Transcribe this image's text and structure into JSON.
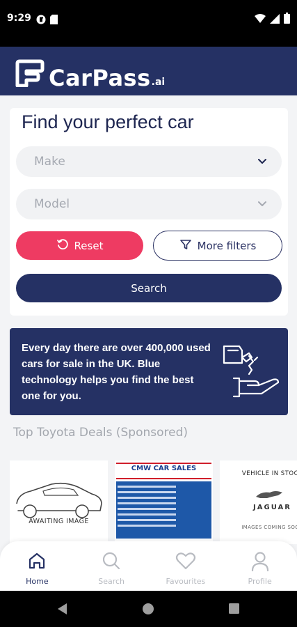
{
  "status_bar": {
    "time": "9:29"
  },
  "header": {
    "logo_text": "CarPass",
    "logo_suffix": ".ai"
  },
  "search_card": {
    "title": "Find your perfect car",
    "make_placeholder": "Make",
    "model_placeholder": "Model",
    "reset_label": "Reset",
    "filters_label": "More filters",
    "search_label": "Search"
  },
  "banner": {
    "text": "Every day there are over 400,000 used cars for sale in the UK. Blue technology helps you find the best one for you."
  },
  "deals": {
    "title": "Top Toyota Deals (Sponsored)",
    "cards": [
      {
        "image_text": "AWAITING IMAGE"
      },
      {
        "image_text": "CMW CAR SALES"
      },
      {
        "top_text": "VEHICLE IN STOCK",
        "brand_text": "JAGUAR",
        "bottom_text": "IMAGES COMING SOON"
      }
    ]
  },
  "bottom_nav": {
    "items": [
      {
        "label": "Home",
        "icon": "home-icon",
        "active": true
      },
      {
        "label": "Search",
        "icon": "search-icon",
        "active": false
      },
      {
        "label": "Favourites",
        "icon": "heart-icon",
        "active": false
      },
      {
        "label": "Profile",
        "icon": "person-icon",
        "active": false
      }
    ]
  },
  "colors": {
    "brand_navy": "#253164",
    "accent_pink": "#ee3b62"
  }
}
